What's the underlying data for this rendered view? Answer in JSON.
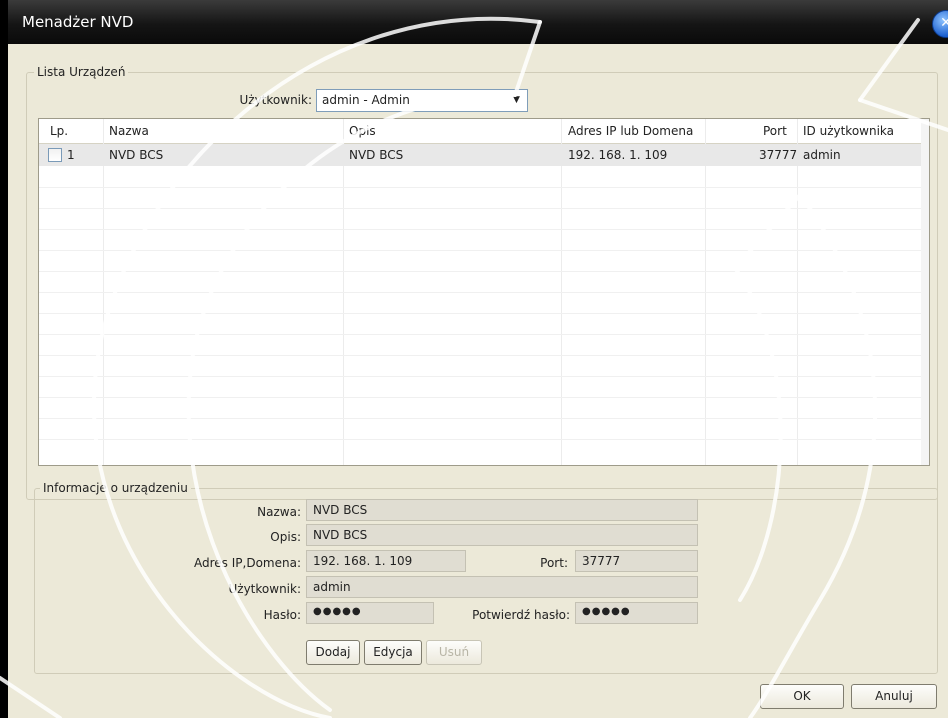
{
  "window": {
    "title": "Menadżer NVD"
  },
  "device_list": {
    "group_label": "Lista Urządzeń",
    "user_label": "Użytkownik:",
    "user_value": "admin - Admin"
  },
  "table": {
    "headers": {
      "lp": "Lp.",
      "nazwa": "Nazwa",
      "opis": "Opis",
      "adres": "Adres IP lub Domena",
      "port": "Port",
      "id": "ID użytkownika"
    },
    "rows": [
      {
        "lp": "1",
        "nazwa": "NVD BCS",
        "opis": "NVD BCS",
        "adres": "192. 168. 1. 109",
        "port": "37777",
        "id": "admin"
      }
    ]
  },
  "info": {
    "group_label": "Informacje o urządzeniu",
    "nazwa_label": "Nazwa:",
    "nazwa_value": "NVD BCS",
    "opis_label": "Opis:",
    "opis_value": "NVD BCS",
    "adres_label": "Adres IP,Domena:",
    "adres_value": "192. 168. 1. 109",
    "port_label": "Port:",
    "port_value": "37777",
    "user_label": "Użytkownik:",
    "user_value": "admin",
    "haslo_label": "Hasło:",
    "haslo_value": "●●●●●",
    "potwierdz_label": "Potwierdź hasło:",
    "potwierdz_value": "●●●●●"
  },
  "buttons": {
    "dodaj": "Dodaj",
    "edycja": "Edycja",
    "usun": "Usuń",
    "ok": "OK",
    "anuluj": "Anuluj"
  },
  "colors": {
    "titlebar": "#151515",
    "dialog_bg": "#ece9d8",
    "close_blue": "#1b5fcf"
  }
}
